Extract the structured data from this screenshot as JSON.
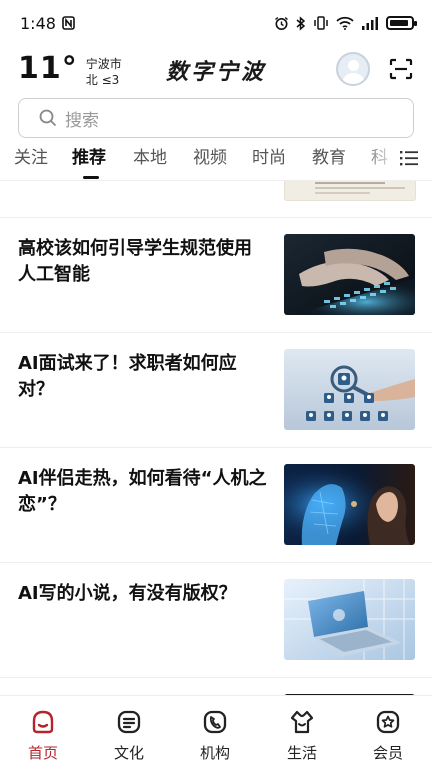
{
  "status_bar": {
    "time": "1:48",
    "icons": [
      "nfc-icon",
      "alarm-icon",
      "bluetooth-icon",
      "vibrate-icon",
      "wifi-icon",
      "signal-icon",
      "battery-icon"
    ]
  },
  "header": {
    "temperature": "11°",
    "city": "宁波市",
    "wind": "北 ≤3",
    "brand": "数字宁波"
  },
  "search": {
    "placeholder": "搜索"
  },
  "tabs": [
    {
      "label": "关注",
      "active": false
    },
    {
      "label": "推荐",
      "active": true
    },
    {
      "label": "本地",
      "active": false
    },
    {
      "label": "视频",
      "active": false
    },
    {
      "label": "时尚",
      "active": false
    },
    {
      "label": "教育",
      "active": false
    },
    {
      "label": "科",
      "active": false
    }
  ],
  "articles": [
    {
      "title": "高校该如何引导学生规范使用人工智能"
    },
    {
      "title": "AI面试来了！求职者如何应对？"
    },
    {
      "title": "AI伴侣走热，如何看待“人机之恋”？"
    },
    {
      "title": "AI写的小说，有没有版权？"
    }
  ],
  "bottom_nav": [
    {
      "label": "首页",
      "icon": "home-icon",
      "active": true
    },
    {
      "label": "文化",
      "icon": "culture-icon",
      "active": false
    },
    {
      "label": "机构",
      "icon": "institution-icon",
      "active": false
    },
    {
      "label": "生活",
      "icon": "life-icon",
      "active": false
    },
    {
      "label": "会员",
      "icon": "member-icon",
      "active": false
    }
  ],
  "colors": {
    "accent": "#b3252b",
    "text": "#111111",
    "muted": "#555555"
  }
}
